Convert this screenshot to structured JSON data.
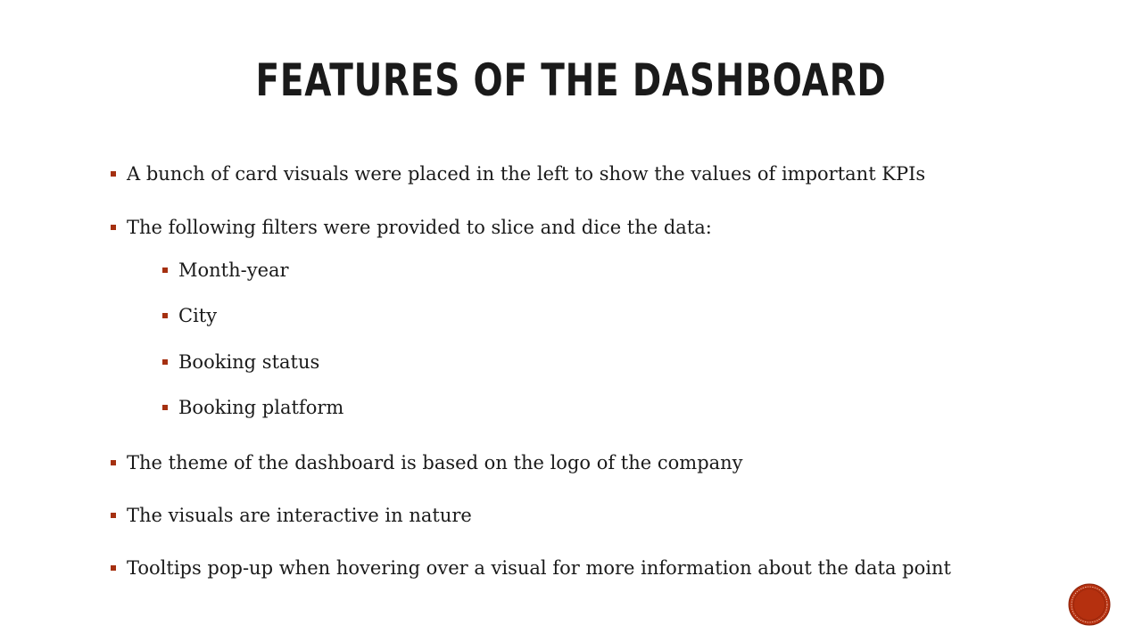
{
  "slide": {
    "title": "FEATURES OF THE DASHBOARD",
    "bullets": [
      {
        "level": 1,
        "text": "A bunch of card visuals were placed in the left to show the values of important KPIs"
      },
      {
        "level": 1,
        "text": "The following filters were provided to slice and dice the data:"
      },
      {
        "level": 2,
        "text": "Month-year"
      },
      {
        "level": 2,
        "text": "City"
      },
      {
        "level": 2,
        "text": "Booking status"
      },
      {
        "level": 2,
        "text": "Booking platform"
      },
      {
        "level": 1,
        "text": "The theme of the dashboard is based on the logo of the company"
      },
      {
        "level": 1,
        "text": "The visuals are interactive in nature"
      },
      {
        "level": 1,
        "text": "Tooltips pop-up when hovering over a visual for more information about the data point"
      }
    ]
  },
  "colors": {
    "bullet_marker": "#a53010",
    "badge": "#b5300f"
  },
  "icons": {
    "corner_badge": "circle-badge-icon"
  }
}
